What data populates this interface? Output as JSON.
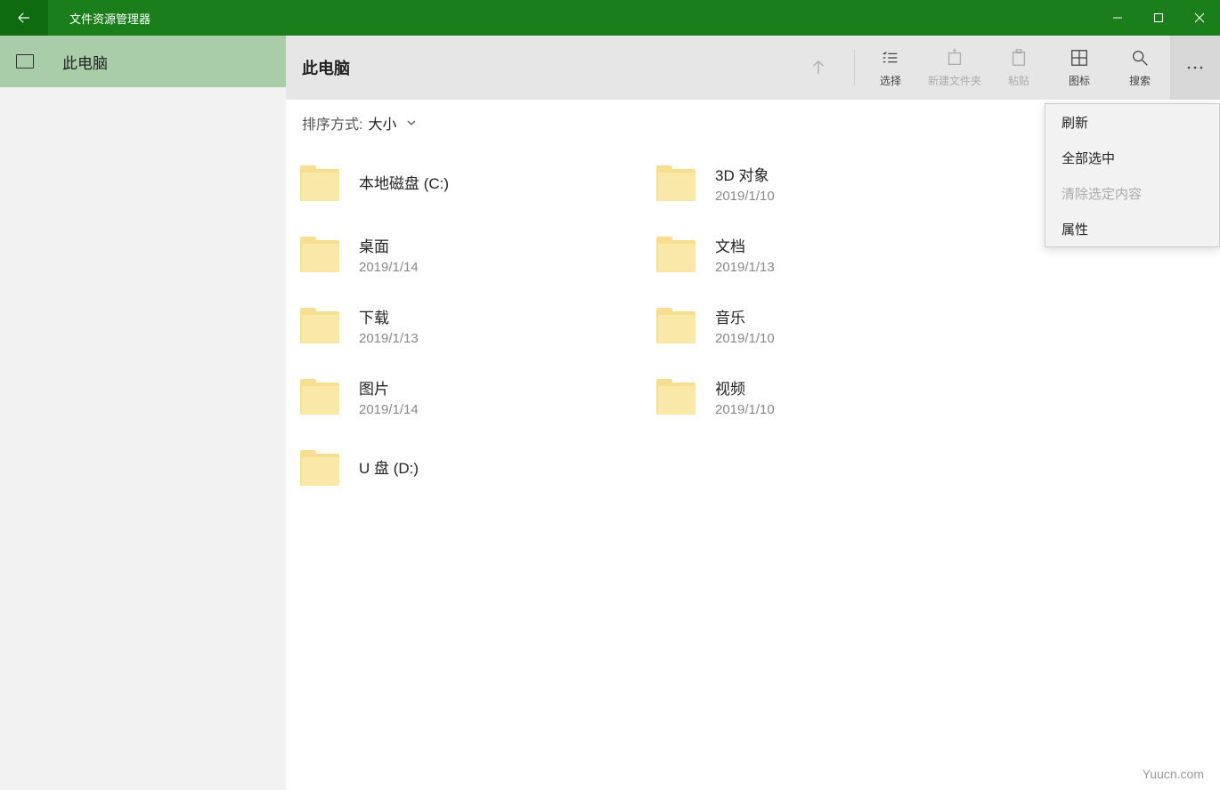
{
  "titlebar": {
    "title": "文件资源管理器"
  },
  "sidebar": {
    "active": {
      "label": "此电脑"
    }
  },
  "toolbar": {
    "title": "此电脑",
    "select": "选择",
    "new_folder": "新建文件夹",
    "paste": "粘贴",
    "icons": "图标",
    "search": "搜索"
  },
  "sort": {
    "prefix": "排序方式:",
    "value": "大小"
  },
  "items": [
    {
      "name": "本地磁盘 (C:)",
      "date": ""
    },
    {
      "name": "3D 对象",
      "date": "2019/1/10"
    },
    {
      "name": "桌面",
      "date": "2019/1/14"
    },
    {
      "name": "文档",
      "date": "2019/1/13"
    },
    {
      "name": "下载",
      "date": "2019/1/13"
    },
    {
      "name": "音乐",
      "date": "2019/1/10"
    },
    {
      "name": "图片",
      "date": "2019/1/14"
    },
    {
      "name": "视频",
      "date": "2019/1/10"
    },
    {
      "name": "U 盘 (D:)",
      "date": ""
    }
  ],
  "context_menu": {
    "refresh": "刷新",
    "select_all": "全部选中",
    "clear_selection": "清除选定内容",
    "properties": "属性"
  },
  "watermark": "Yuucn.com"
}
